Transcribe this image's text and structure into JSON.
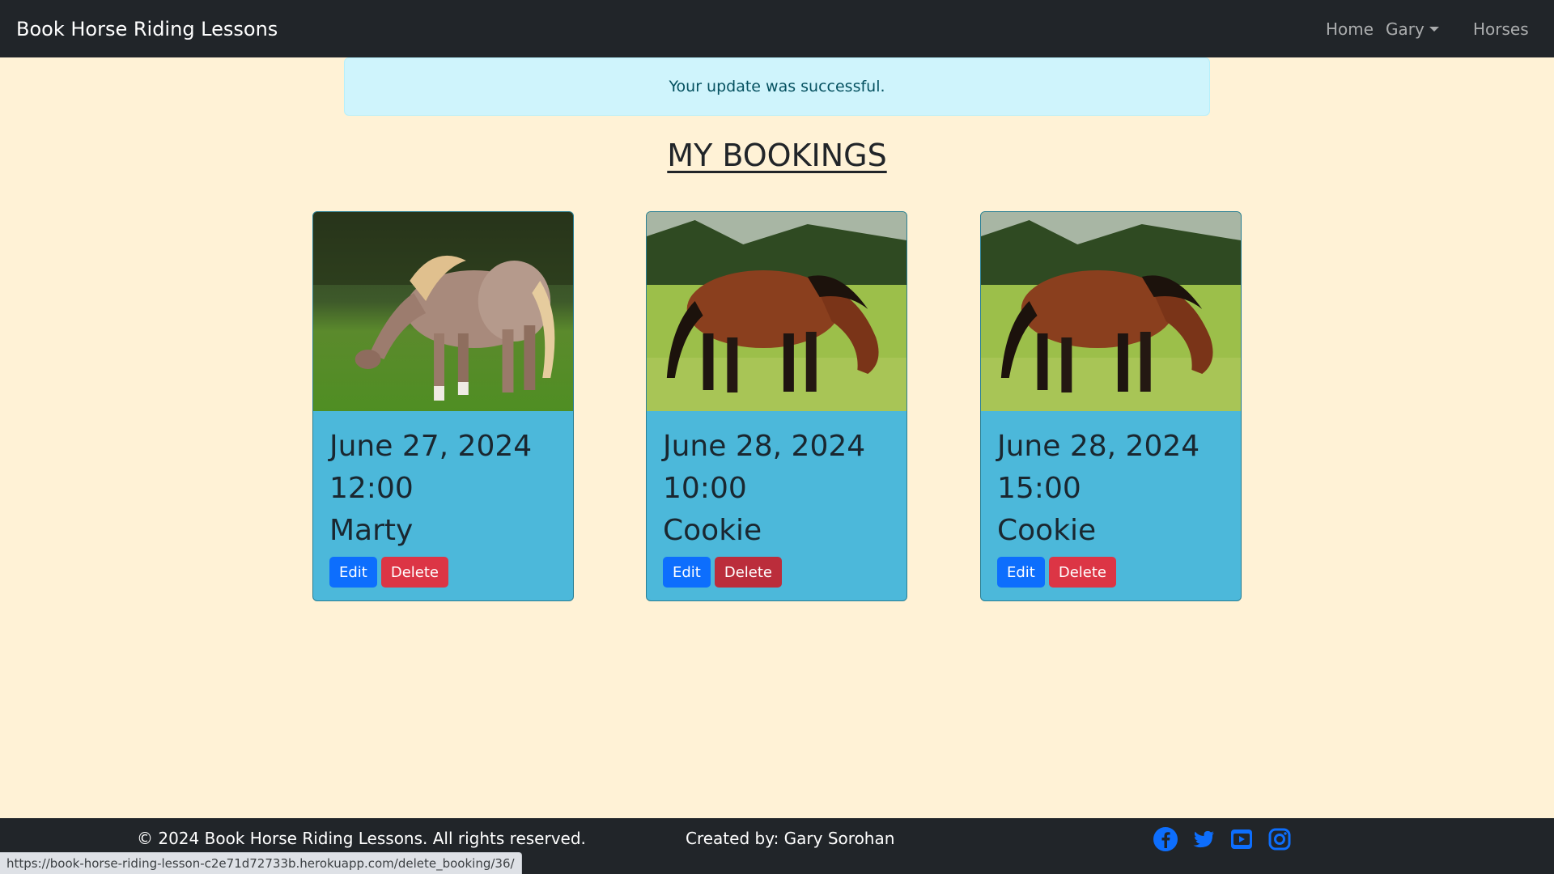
{
  "navbar": {
    "brand": "Book Horse Riding Lessons",
    "links": {
      "home": "Home",
      "user": "Gary",
      "horses": "Horses"
    }
  },
  "alert": {
    "message": "Your update was successful."
  },
  "page": {
    "title": "MY BOOKINGS"
  },
  "bookings": [
    {
      "date": "June 27, 2024",
      "time": "12:00",
      "horse": "Marty",
      "edit_label": "Edit",
      "delete_label": "Delete"
    },
    {
      "date": "June 28, 2024",
      "time": "10:00",
      "horse": "Cookie",
      "edit_label": "Edit",
      "delete_label": "Delete"
    },
    {
      "date": "June 28, 2024",
      "time": "15:00",
      "horse": "Cookie",
      "edit_label": "Edit",
      "delete_label": "Delete"
    }
  ],
  "footer": {
    "copyright": "© 2024 Book Horse Riding Lessons. All rights reserved.",
    "credit": "Created by: Gary Sorohan",
    "socials": [
      "facebook-icon",
      "twitter-icon",
      "youtube-icon",
      "instagram-icon"
    ],
    "social_color": "#0d6efd"
  },
  "status_bar": {
    "url": "https://book-horse-riding-lesson-c2e71d72733b.herokuapp.com/delete_booking/36/"
  },
  "colors": {
    "page_bg": "#fff2d6",
    "navbar_bg": "#212529",
    "card_bg": "#4cb8da",
    "alert_bg": "#cff4fc",
    "edit_btn": "#0d6efd",
    "delete_btn": "#dc3545"
  }
}
